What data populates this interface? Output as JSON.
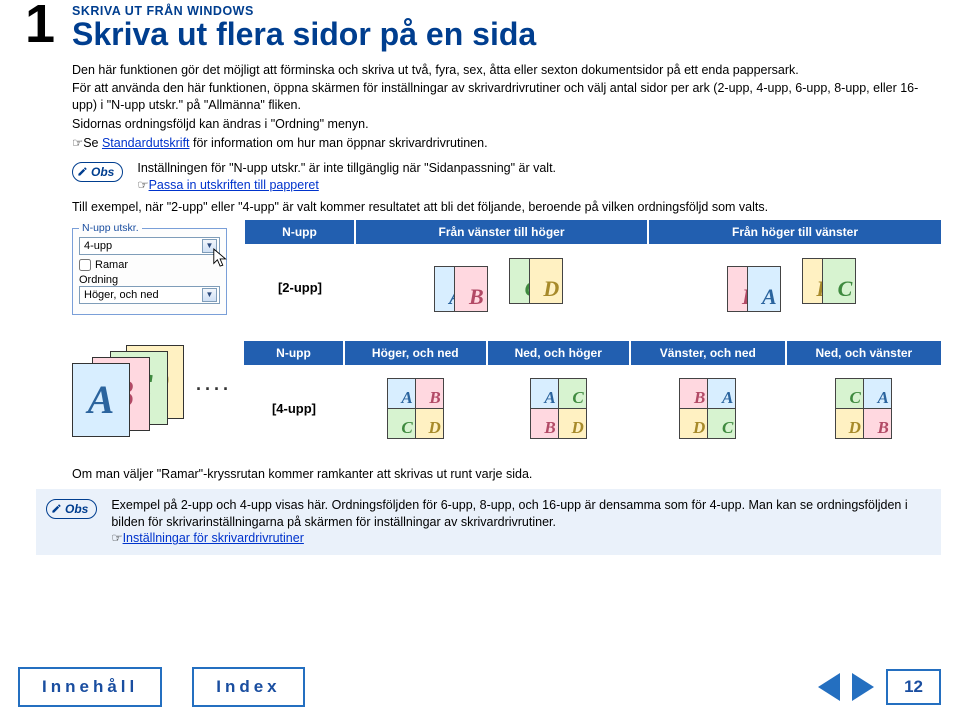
{
  "chapter_number": "1",
  "section_small": "SKRIVA UT FRÅN WINDOWS",
  "section_big": "Skriva ut flera sidor på en sida",
  "intro_p1": "Den här funktionen gör det möjligt att förminska och skriva ut två, fyra, sex, åtta eller sexton dokumentsidor på ett enda pappersark.",
  "intro_p2": "För att använda den här funktionen, öppna skärmen för inställningar av skrivardrivrutiner och välj antal sidor per ark (2-upp, 4-upp, 6-upp, 8-upp, eller 16-upp) i \"N-upp utskr.\" på \"Allmänna\" fliken.",
  "intro_p3": "Sidornas ordningsföljd kan ändras i \"Ordning\" menyn.",
  "see_prefix": "☞Se ",
  "see_link": "Standardutskrift",
  "see_suffix": " för information om hur man öppnar skrivardrivrutinen.",
  "obs_label": "Obs",
  "obs1_line1": "Inställningen för \"N-upp utskr.\" är inte tillgänglig när \"Sidanpassning\" är valt.",
  "obs1_link_prefix": "☞",
  "obs1_link": "Passa in utskriften till papperet",
  "example_intro": "Till exempel, när \"2-upp\" eller \"4-upp\" är valt kommer resultatet att bli det följande, beroende på vilken ordningsföljd som valts.",
  "dialog": {
    "group_label": "N-upp utskr.",
    "select_value": "4-upp",
    "check_ramar": "Ramar",
    "label_ordning": "Ordning",
    "select_order": "Höger, och ned"
  },
  "table1": {
    "h1": "N-upp",
    "h2": "Från vänster till höger",
    "h3": "Från höger till vänster",
    "row_label": "[2-upp]"
  },
  "table2": {
    "h1": "N-upp",
    "h2": "Höger, och ned",
    "h3": "Ned, och höger",
    "h4": "Vänster, och ned",
    "h5": "Ned, och vänster",
    "row_label": "[4-upp]"
  },
  "letters": {
    "A": "A",
    "B": "B",
    "C": "C",
    "D": "D"
  },
  "frames_text": "Om man väljer \"Ramar\"-kryssrutan kommer ramkanter att skrivas ut runt varje sida.",
  "obs2_text": "Exempel på 2-upp och 4-upp visas här. Ordningsföljden för 6-upp, 8-upp, och 16-upp är densamma som för 4-upp. Man kan se ordningsföljden i bilden för skrivarinställningarna på skärmen för inställningar av skrivardrivrutiner.",
  "obs2_link_prefix": "☞",
  "obs2_link": "Inställningar för skrivardrivrutiner",
  "footer": {
    "innehall": "Innehåll",
    "index": "Index",
    "page": "12"
  }
}
